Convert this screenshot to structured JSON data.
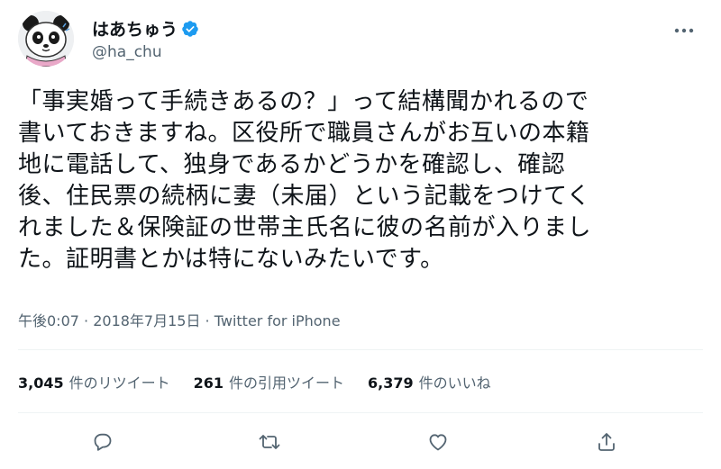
{
  "user": {
    "display_name": "はあちゅう",
    "handle": "@ha_chu",
    "avatar_icon": "panda-avatar",
    "verified_icon": "verified-badge-icon"
  },
  "tweet": {
    "lines": [
      "「事実婚って手続きあるの？」って結構聞かれるので",
      "書いておきますね。区役所で職員さんがお互いの本籍",
      "地に電話して、独身であるかどうかを確認し、確認",
      "後、住民票の続柄に妻（未届）という記載をつけてく",
      "れました＆保険証の世帯主氏名に彼の名前が入りまし",
      "た。証明書とかは特にないみたいです。"
    ],
    "time": "午後0:07",
    "date": "2018年7月15日",
    "separator": " · ",
    "source": "Twitter for iPhone"
  },
  "stats": {
    "retweets_count": "3,045",
    "retweets_label": "件のリツイート",
    "quotes_count": "261",
    "quotes_label": "件の引用ツイート",
    "likes_count": "6,379",
    "likes_label": "件のいいね"
  },
  "actions": [
    "reply-icon",
    "retweet-icon",
    "like-icon",
    "share-icon"
  ],
  "colors": {
    "text": "#0f1419",
    "secondary": "#536471",
    "verified": "#1d9bf0",
    "divider": "#eff3f4"
  }
}
